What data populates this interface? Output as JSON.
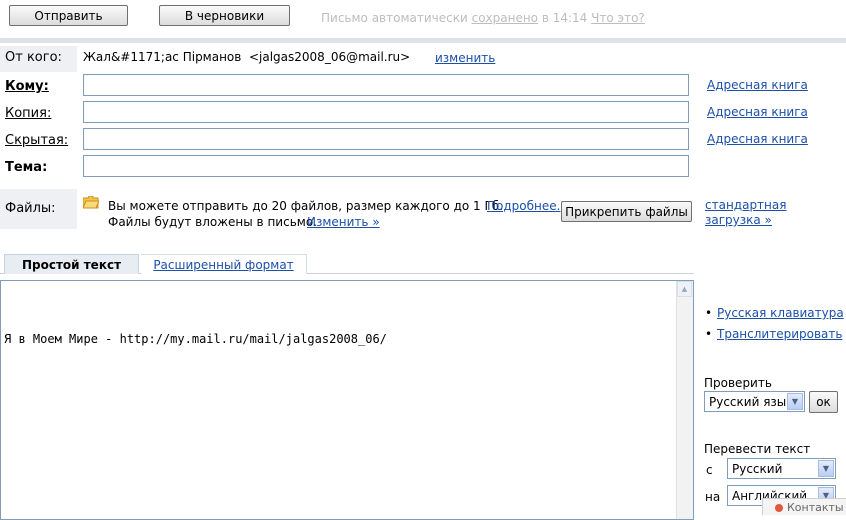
{
  "toolbar": {
    "send_label": "Отправить",
    "drafts_label": "В черновики",
    "autosave_prefix": "Письмо автоматически ",
    "autosave_link": "сохранено",
    "autosave_time": " в 14:14 ",
    "whats_this": "Что это?"
  },
  "from": {
    "label": "От кого:",
    "value": "Жал&#1171;ас Пірманов  <jalgas2008_06@mail.ru>",
    "change_link": "изменить"
  },
  "to": {
    "label": "Кому:",
    "value": "",
    "addressbook": "Адресная книга"
  },
  "cc": {
    "label": "Копия:",
    "value": "",
    "addressbook": "Адресная книга"
  },
  "bcc": {
    "label": "Скрытая:",
    "value": "",
    "addressbook": "Адресная книга"
  },
  "subject": {
    "label": "Тема:",
    "value": ""
  },
  "files": {
    "label": "Файлы:",
    "info_line1": "Вы можете отправить до 20 файлов, размер каждого до 1 Гб.",
    "more_link": "Подробнее.",
    "info_line2": "Файлы будут вложены в письмо.",
    "change_link": "Изменить »",
    "attach_button": "Прикрепить файлы",
    "standard_upload": "стандартная загрузка »"
  },
  "tabs": {
    "plain": "Простой текст",
    "rich": "Расширенный формат"
  },
  "editor": {
    "body_text": "Я в Моем Мире - http://my.mail.ru/mail/jalgas2008_06/"
  },
  "sidebar": {
    "russian_keyboard": "Русская клавиатура",
    "transliterate": "Транслитерировать",
    "check_label": "Проверить",
    "check_language": "Русский язы",
    "ok_button": "ок",
    "translate_label": "Перевести текст",
    "from_label": "с",
    "from_language": "Русский",
    "to_label": "на",
    "to_language": "Английский",
    "contacts_fragment": "Контакты"
  },
  "colors": {
    "link": "#1b4fa8",
    "label_bg": "#eef0f3",
    "field_border": "#7f9db9"
  }
}
